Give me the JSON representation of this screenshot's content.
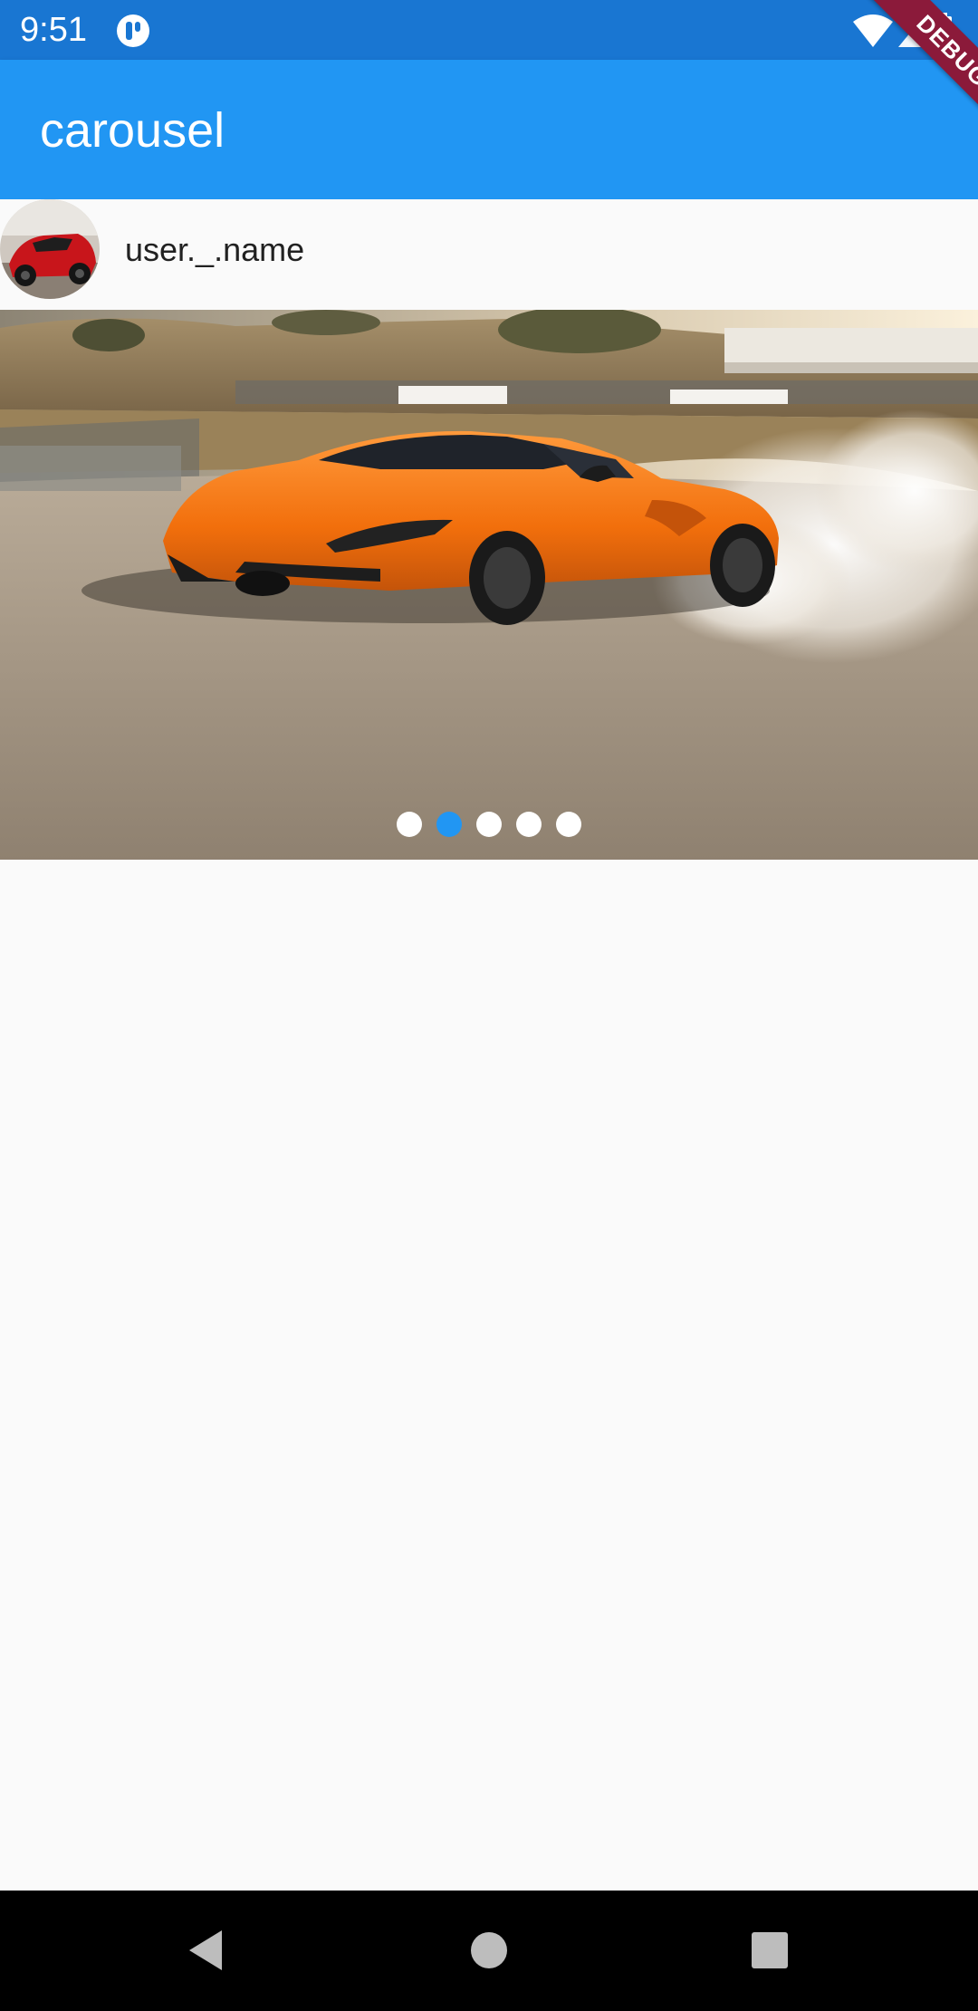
{
  "status_bar": {
    "time": "9:51",
    "icons": [
      "app-notification-icon",
      "wifi-icon",
      "cellular-signal-icon",
      "battery-icon"
    ],
    "background_color": "#1976d2"
  },
  "debug_banner": {
    "label": "DEBUG",
    "color": "#8b1a3a"
  },
  "app_bar": {
    "title": "carousel",
    "background_color": "#2196f3"
  },
  "user": {
    "name": "user._.name",
    "avatar_icon": "red-car-avatar"
  },
  "carousel": {
    "image": "orange-sports-car-drifting-photo",
    "page_count": 5,
    "active_index": 1,
    "active_dot_color": "#2196f3",
    "inactive_dot_color": "#ffffff"
  },
  "nav_bar": {
    "buttons": [
      "back-icon",
      "home-icon",
      "recents-icon"
    ]
  }
}
